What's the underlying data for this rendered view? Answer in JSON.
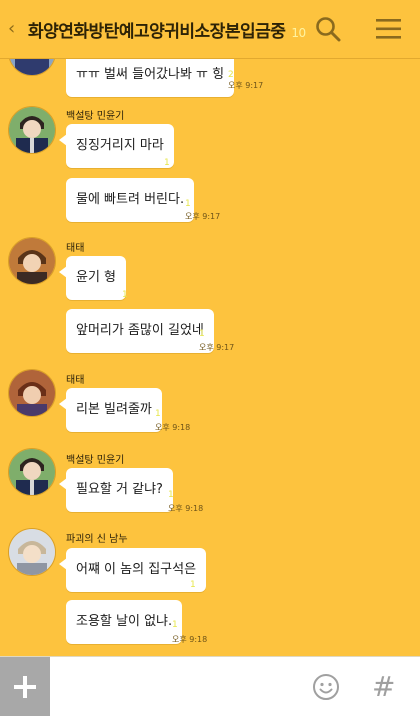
{
  "header": {
    "title": "화양연화방탄예고양귀비소장본입금중",
    "member_count": "10",
    "back_icon": "chevron-left-icon",
    "search_icon": "search-icon",
    "menu_icon": "hamburger-menu-icon"
  },
  "messages": [
    {
      "sender": "",
      "text": "ㅠㅠ 벌써 들어갔나봐 ㅠ 힝",
      "time": "오후 9:17",
      "read": "2"
    },
    {
      "sender": "백설탕 민윤기",
      "text": "징징거리지 마라",
      "time": "",
      "read": "1"
    },
    {
      "sender": "",
      "text": "물에 빠트려 버린다.",
      "time": "오후 9:17",
      "read": "1"
    },
    {
      "sender": "태태",
      "text": "윤기 형",
      "time": "",
      "read": "1"
    },
    {
      "sender": "",
      "text": "앞머리가 좀많이 길었네",
      "time": "오후 9:17",
      "read": "1"
    },
    {
      "sender": "태태",
      "text": "리본 빌려줄까",
      "time": "오후 9:18",
      "read": "1"
    },
    {
      "sender": "백설탕 민윤기",
      "text": "필요할 거 같냐?",
      "time": "오후 9:18",
      "read": "1"
    },
    {
      "sender": "파괴의 신 남누",
      "text": "어쨰 이 놈의 집구석은",
      "time": "",
      "read": "1"
    },
    {
      "sender": "",
      "text": "조용할 날이 없냐.",
      "time": "오후 9:18",
      "read": "1"
    }
  ],
  "input": {
    "placeholder": ""
  },
  "colors": {
    "background": "#fdc33e",
    "bubble": "#ffffff",
    "attach": "#a8a8a8"
  }
}
